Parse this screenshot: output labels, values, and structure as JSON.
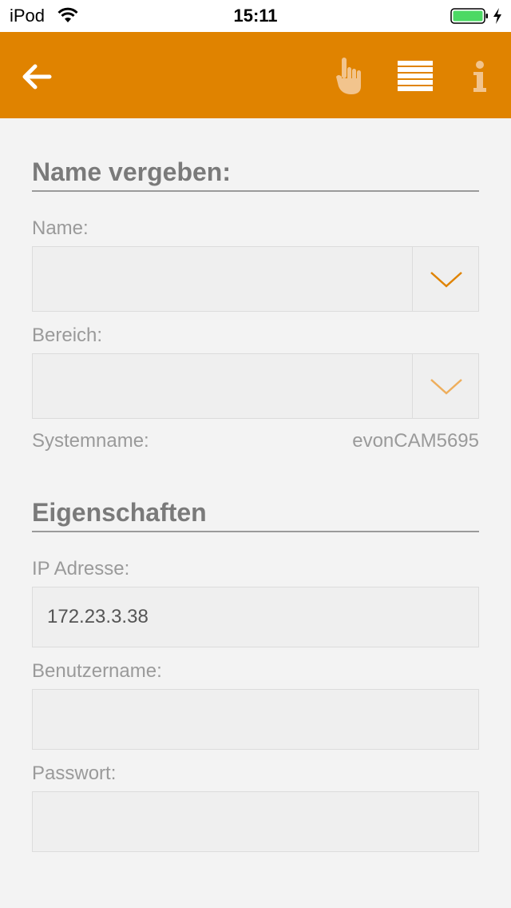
{
  "status_bar": {
    "carrier": "iPod",
    "time": "15:11",
    "battery_color": "#4cd964"
  },
  "nav": {
    "background": "#e08300",
    "icons": [
      "back-arrow-icon",
      "hand-pointer-icon",
      "list-icon",
      "info-icon"
    ]
  },
  "section_name": {
    "title": "Name vergeben:",
    "name_label": "Name:",
    "name_value": "",
    "area_label": "Bereich:",
    "area_value": "",
    "system_label": "Systemname:",
    "system_value": "evonCAM5695"
  },
  "section_props": {
    "title": "Eigenschaften",
    "ip_label": "IP Adresse:",
    "ip_value": "172.23.3.38",
    "user_label": "Benutzername:",
    "user_value": "",
    "password_label": "Passwort:",
    "password_value": ""
  }
}
